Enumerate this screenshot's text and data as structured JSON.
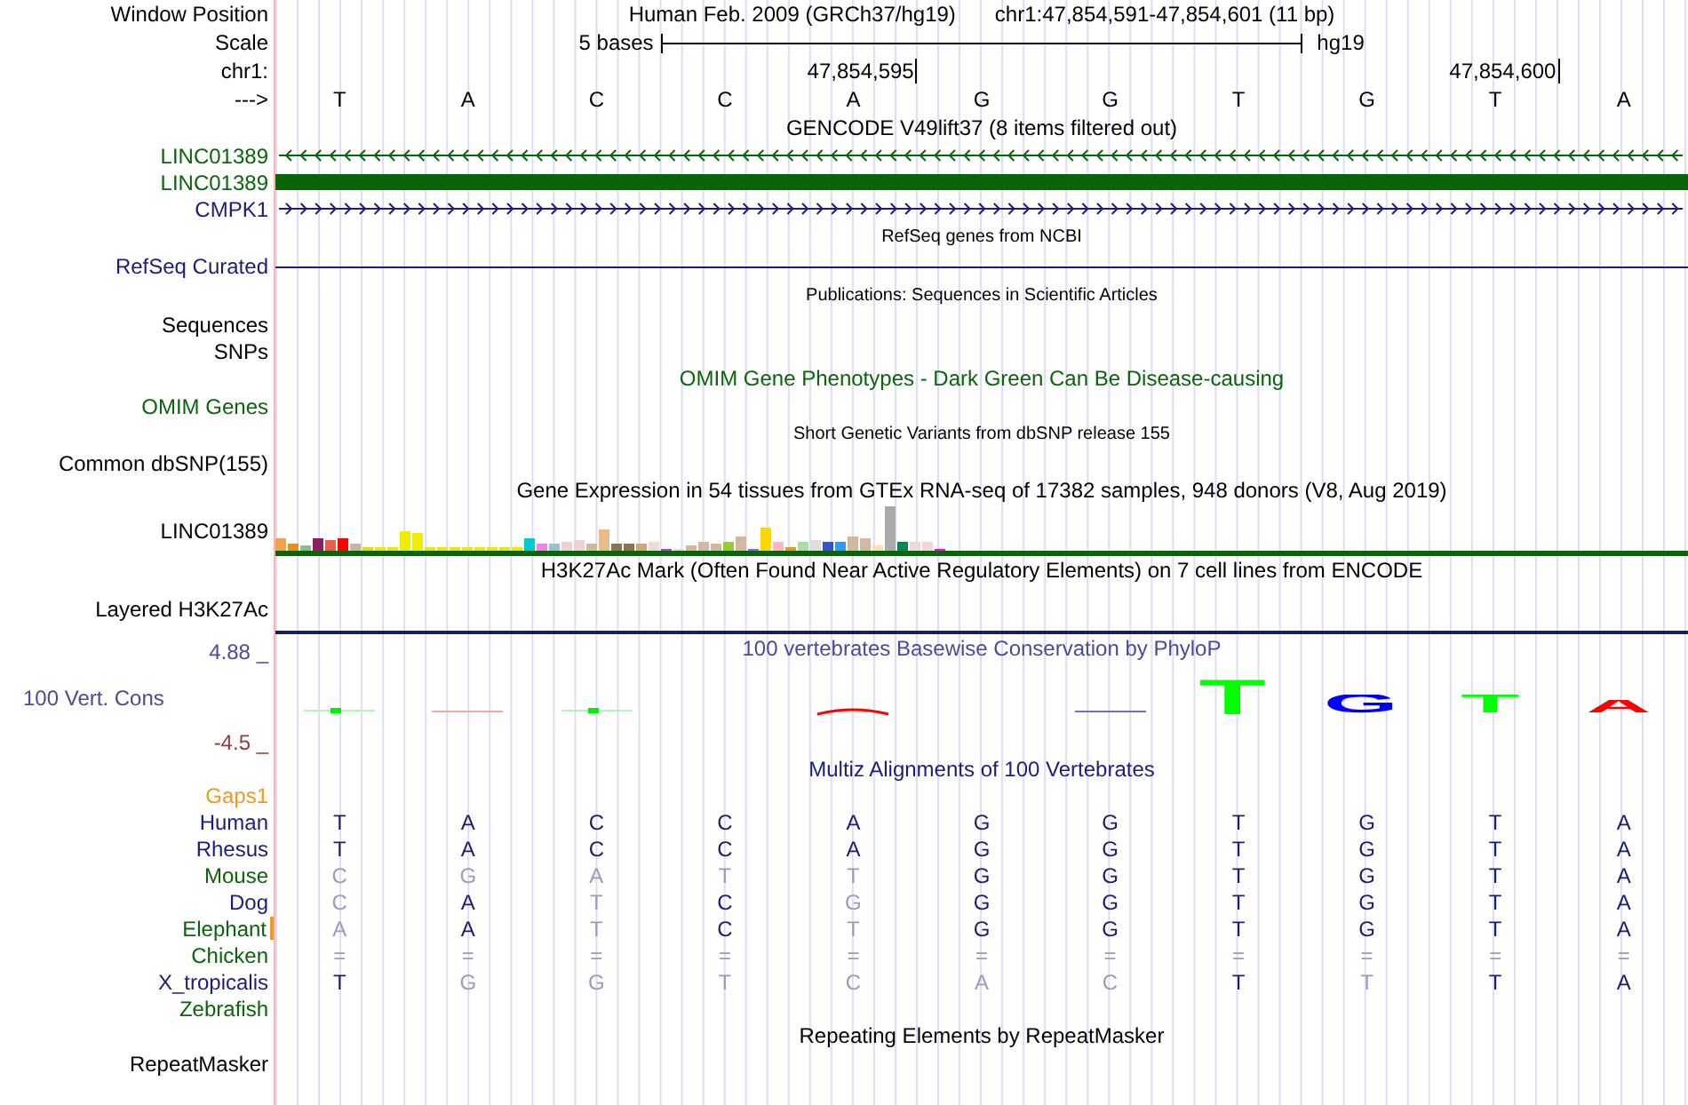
{
  "position": {
    "label": "Window Position",
    "assembly": "Human Feb. 2009 (GRCh37/hg19)",
    "region": "chr1:47,854,591-47,854,601 (11 bp)"
  },
  "scale": {
    "label": "Scale",
    "span": "5 bases",
    "assembly": "hg19"
  },
  "coordinates": {
    "label": "chr1:",
    "ticks": [
      "47,854,595",
      "47,854,600"
    ]
  },
  "strand": {
    "label": "--->",
    "bases": [
      "T",
      "A",
      "C",
      "C",
      "A",
      "G",
      "G",
      "T",
      "G",
      "T",
      "A"
    ]
  },
  "tracks": [
    {
      "kind": "title",
      "text": "GENCODE V49lift37 (8 items filtered out)",
      "color": "#000000"
    },
    {
      "kind": "leftarrows",
      "label": "LINC01389",
      "color": "#0a640a"
    },
    {
      "kind": "block",
      "label": "LINC01389",
      "color": "#0a640a"
    },
    {
      "kind": "rightarrows",
      "label": "CMPK1",
      "color": "#1c1c80"
    },
    {
      "kind": "subtitle",
      "text": "RefSeq genes from NCBI",
      "color": "#000000"
    },
    {
      "kind": "line",
      "label": "RefSeq Curated",
      "color": "#1c1c80"
    },
    {
      "kind": "subtitle",
      "text": "Publications: Sequences in Scientific Articles",
      "color": "#000000"
    },
    {
      "kind": "label",
      "label": "Sequences",
      "color": "#000000"
    },
    {
      "kind": "label",
      "label": "SNPs",
      "color": "#000000"
    },
    {
      "kind": "title",
      "text": "OMIM Gene Phenotypes - Dark Green Can Be Disease-causing",
      "color": "#0a640a"
    },
    {
      "kind": "label",
      "label": "OMIM Genes",
      "color": "#0a640a"
    },
    {
      "kind": "subtitle",
      "text": "Short Genetic Variants from dbSNP release 155",
      "color": "#000000"
    },
    {
      "kind": "label",
      "label": "Common dbSNP(155)",
      "color": "#000000"
    },
    {
      "kind": "title",
      "text": "Gene Expression in 54 tissues from GTEx RNA-seq of 17382 samples, 948 donors (V8, Aug 2019)",
      "color": "#000000"
    },
    {
      "kind": "expression",
      "label": "LINC01389",
      "color": "#000000"
    },
    {
      "kind": "title",
      "text": "H3K27Ac Mark (Often Found Near Active Regulatory Elements) on 7 cell lines from ENCODE",
      "color": "#000000"
    },
    {
      "kind": "layered",
      "label": "Layered H3K27Ac",
      "color": "#000000"
    },
    {
      "kind": "conservation",
      "max": "4.88 _",
      "label": "100 Vert. Cons",
      "min": "-4.5 _",
      "title": "100 vertebrates Basewise Conservation by PhyloP",
      "color": "#4a4a9c",
      "logo": [
        {
          "kind": "mark",
          "color": "#00ee00"
        },
        {
          "kind": "line",
          "color": "#f0a8a8"
        },
        {
          "kind": "mark",
          "color": "#00ee00"
        },
        {
          "kind": "none"
        },
        {
          "kind": "bump",
          "color": "#ff0000"
        },
        {
          "kind": "none"
        },
        {
          "kind": "line",
          "color": "#7070c0"
        },
        {
          "kind": "large",
          "text": "T",
          "color": "#00ff00"
        },
        {
          "kind": "medium",
          "text": "G",
          "color": "#0000ff"
        },
        {
          "kind": "medium",
          "text": "T",
          "color": "#00ff00"
        },
        {
          "kind": "small",
          "text": "A",
          "color": "#ff0000"
        }
      ]
    },
    {
      "kind": "title",
      "text": "Multiz Alignments of 100 Vertebrates",
      "color": "#1c1c80"
    },
    {
      "kind": "gaps",
      "label": "Gaps1",
      "color": "#f09a20"
    },
    {
      "kind": "species",
      "label": "Human",
      "color": "#1c1c80",
      "gap": false,
      "bases": [
        {
          "text": "T",
          "faint": false
        },
        {
          "text": "A",
          "faint": false
        },
        {
          "text": "C",
          "faint": false
        },
        {
          "text": "C",
          "faint": false
        },
        {
          "text": "A",
          "faint": false
        },
        {
          "text": "G",
          "faint": false
        },
        {
          "text": "G",
          "faint": false
        },
        {
          "text": "T",
          "faint": false
        },
        {
          "text": "G",
          "faint": false
        },
        {
          "text": "T",
          "faint": false
        },
        {
          "text": "A",
          "faint": false
        }
      ]
    },
    {
      "kind": "species",
      "label": "Rhesus",
      "color": "#1c1c80",
      "gap": false,
      "bases": [
        {
          "text": "T",
          "faint": false
        },
        {
          "text": "A",
          "faint": false
        },
        {
          "text": "C",
          "faint": false
        },
        {
          "text": "C",
          "faint": false
        },
        {
          "text": "A",
          "faint": false
        },
        {
          "text": "G",
          "faint": false
        },
        {
          "text": "G",
          "faint": false
        },
        {
          "text": "T",
          "faint": false
        },
        {
          "text": "G",
          "faint": false
        },
        {
          "text": "T",
          "faint": false
        },
        {
          "text": "A",
          "faint": false
        }
      ]
    },
    {
      "kind": "species",
      "label": "Mouse",
      "color": "#0a640a",
      "gap": false,
      "bases": [
        {
          "text": "C",
          "faint": true
        },
        {
          "text": "G",
          "faint": true
        },
        {
          "text": "A",
          "faint": true
        },
        {
          "text": "T",
          "faint": true
        },
        {
          "text": "T",
          "faint": true
        },
        {
          "text": "G",
          "faint": false
        },
        {
          "text": "G",
          "faint": false
        },
        {
          "text": "T",
          "faint": false
        },
        {
          "text": "G",
          "faint": false
        },
        {
          "text": "T",
          "faint": false
        },
        {
          "text": "A",
          "faint": false
        }
      ]
    },
    {
      "kind": "species",
      "label": "Dog",
      "color": "#1c1c80",
      "gap": false,
      "bases": [
        {
          "text": "C",
          "faint": true
        },
        {
          "text": "A",
          "faint": false
        },
        {
          "text": "T",
          "faint": true
        },
        {
          "text": "C",
          "faint": false
        },
        {
          "text": "G",
          "faint": true
        },
        {
          "text": "G",
          "faint": false
        },
        {
          "text": "G",
          "faint": false
        },
        {
          "text": "T",
          "faint": false
        },
        {
          "text": "G",
          "faint": false
        },
        {
          "text": "T",
          "faint": false
        },
        {
          "text": "A",
          "faint": false
        }
      ]
    },
    {
      "kind": "species",
      "label": "Elephant",
      "color": "#0a640a",
      "gap": true,
      "bases": [
        {
          "text": "A",
          "faint": true
        },
        {
          "text": "A",
          "faint": false
        },
        {
          "text": "T",
          "faint": true
        },
        {
          "text": "C",
          "faint": false
        },
        {
          "text": "T",
          "faint": true
        },
        {
          "text": "G",
          "faint": false
        },
        {
          "text": "G",
          "faint": false
        },
        {
          "text": "T",
          "faint": false
        },
        {
          "text": "G",
          "faint": false
        },
        {
          "text": "T",
          "faint": false
        },
        {
          "text": "A",
          "faint": false
        }
      ]
    },
    {
      "kind": "species",
      "label": "Chicken",
      "color": "#0a640a",
      "gap": false,
      "bases": [
        {
          "text": "=",
          "faint": true
        },
        {
          "text": "=",
          "faint": true
        },
        {
          "text": "=",
          "faint": true
        },
        {
          "text": "=",
          "faint": true
        },
        {
          "text": "=",
          "faint": true
        },
        {
          "text": "=",
          "faint": true
        },
        {
          "text": "=",
          "faint": true
        },
        {
          "text": "=",
          "faint": true
        },
        {
          "text": "=",
          "faint": true
        },
        {
          "text": "=",
          "faint": true
        },
        {
          "text": "=",
          "faint": true
        }
      ]
    },
    {
      "kind": "species",
      "label": "X_tropicalis",
      "color": "#1c1c80",
      "gap": false,
      "bases": [
        {
          "text": "T",
          "faint": false
        },
        {
          "text": "G",
          "faint": true
        },
        {
          "text": "G",
          "faint": true
        },
        {
          "text": "T",
          "faint": true
        },
        {
          "text": "C",
          "faint": true
        },
        {
          "text": "A",
          "faint": true
        },
        {
          "text": "C",
          "faint": true
        },
        {
          "text": "T",
          "faint": false
        },
        {
          "text": "T",
          "faint": true
        },
        {
          "text": "T",
          "faint": false
        },
        {
          "text": "A",
          "faint": false
        }
      ]
    },
    {
      "kind": "species",
      "label": "Zebrafish",
      "color": "#0a640a",
      "gap": false
    },
    {
      "kind": "title",
      "text": "Repeating Elements by RepeatMasker",
      "color": "#000000"
    },
    {
      "kind": "label",
      "label": "RepeatMasker",
      "color": "#000000"
    }
  ]
}
